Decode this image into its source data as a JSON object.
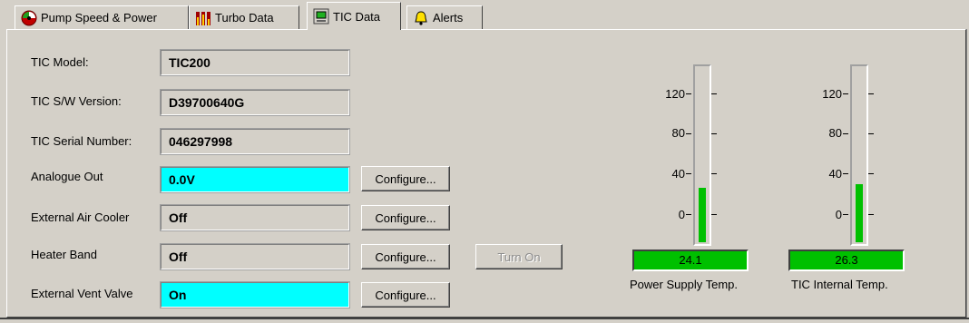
{
  "tabs": [
    {
      "label": "Pump Speed & Power",
      "icon": "speed-gauge-icon"
    },
    {
      "label": "Turbo Data",
      "icon": "bar-graph-icon"
    },
    {
      "label": "TIC Data",
      "icon": "monitor-icon"
    },
    {
      "label": "Alerts",
      "icon": "bell-icon"
    }
  ],
  "fields": {
    "model": {
      "label": "TIC Model:",
      "value": "TIC200"
    },
    "sw_version": {
      "label": "TIC S/W Version:",
      "value": "D39700640G"
    },
    "serial": {
      "label": "TIC Serial Number:",
      "value": "046297998"
    },
    "analogue_out": {
      "label": "Analogue Out",
      "value": "0.0V"
    },
    "air_cooler": {
      "label": "External Air Cooler",
      "value": "Off"
    },
    "heater_band": {
      "label": "Heater Band",
      "value": "Off"
    },
    "vent_valve": {
      "label": "External Vent Valve",
      "value": "On"
    }
  },
  "buttons": {
    "configure": "Configure...",
    "turn_on": "Turn On"
  },
  "gauges": [
    {
      "caption": "Power Supply Temp.",
      "value": "24.1",
      "ticks": [
        "120",
        "80",
        "40",
        "0"
      ]
    },
    {
      "caption": "TIC Internal Temp.",
      "value": "26.3",
      "ticks": [
        "120",
        "80",
        "40",
        "0"
      ]
    }
  ],
  "colors": {
    "cyan_field": "#00ffff",
    "gauge_green": "#00c000"
  }
}
